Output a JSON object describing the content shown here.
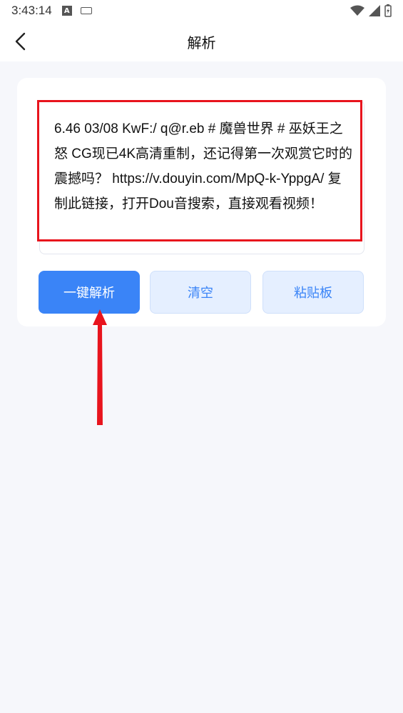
{
  "status_bar": {
    "time": "3:43:14",
    "a_icon_letter": "A"
  },
  "header": {
    "title": "解析"
  },
  "input": {
    "text": "6.46 03/08 KwF:/ q@r.eb # 魔兽世界 # 巫妖王之怒 CG现已4K高清重制，还记得第一次观赏它时的震撼吗？ https://v.douyin.com/MpQ-k-YppgA/ 复制此链接，打开Dou音搜索，直接观看视频！"
  },
  "buttons": {
    "parse": "一键解析",
    "clear": "清空",
    "paste": "粘贴板"
  },
  "colors": {
    "primary": "#3a84f7",
    "secondary_bg": "#e5efff",
    "annotation_red": "#e8141d",
    "page_bg": "#f6f7fb"
  }
}
